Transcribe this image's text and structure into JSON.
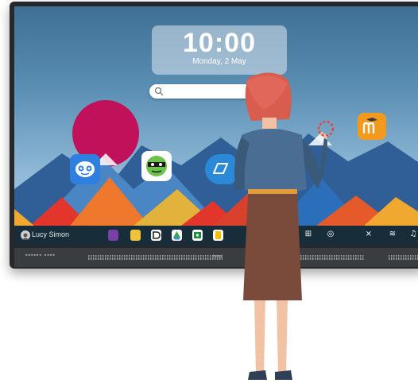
{
  "clock": {
    "time": "10:00",
    "date": "Monday, 2 May"
  },
  "search": {
    "placeholder": ""
  },
  "taskbar": {
    "user_name": "Lucy Simon"
  },
  "grill": {
    "brand_left": "▪▪▪▪▪▪ ▪▪▪▪",
    "brand_mid": "benq"
  },
  "apps": [
    {
      "icon": "classdojo-app-icon",
      "color": "#2e7fe0"
    },
    {
      "icon": "mask-face-app-icon",
      "color": "#3a9a3a"
    },
    {
      "icon": "edu-app-icon",
      "color": "#2a8ad8"
    },
    {
      "icon": "moodle-app-icon",
      "color": "#f39a1e"
    }
  ],
  "colors": {
    "accent": "#e84a4a",
    "taskbar": "#14282d",
    "bezel": "#26292c"
  }
}
